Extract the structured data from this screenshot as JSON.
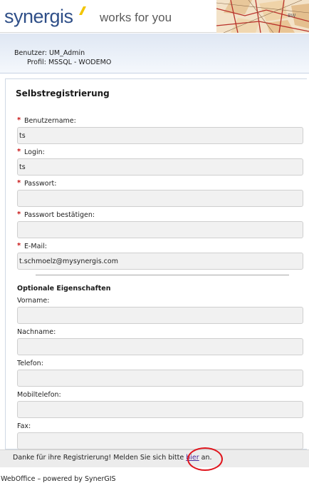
{
  "header": {
    "brand": "synergis",
    "tagline": "works for you"
  },
  "user_info": {
    "user_label": "Benutzer:",
    "user_value": "UM_Admin",
    "profile_label": "Profil:",
    "profile_value": "MSSQL - WODEMO"
  },
  "form": {
    "title": "Selbstregistrierung",
    "required_marker": "*",
    "fields": [
      {
        "label": "Benutzername:",
        "value": "ts"
      },
      {
        "label": "Login:",
        "value": "ts"
      },
      {
        "label": "Passwort:",
        "value": ""
      },
      {
        "label": "Passwort bestätigen:",
        "value": ""
      },
      {
        "label": "E-Mail:",
        "value": "t.schmoelz@mysynergis.com"
      }
    ],
    "optional_title": "Optionale Eigenschaften",
    "optional_fields": [
      {
        "label": "Vorname:",
        "value": ""
      },
      {
        "label": "Nachname:",
        "value": ""
      },
      {
        "label": "Telefon:",
        "value": ""
      },
      {
        "label": "Mobiltelefon:",
        "value": ""
      },
      {
        "label": "Fax:",
        "value": ""
      }
    ]
  },
  "note": {
    "before": "Danke für ihre Registrierung! Melden Sie sich bitte ",
    "link": "hier",
    "after": " an."
  },
  "footer": {
    "powered": "WebOffice – powered by SynerGIS"
  },
  "colors": {
    "brand_blue": "#2f4f88",
    "required_red": "#c81414",
    "highlight_circle": "#e0151d"
  }
}
